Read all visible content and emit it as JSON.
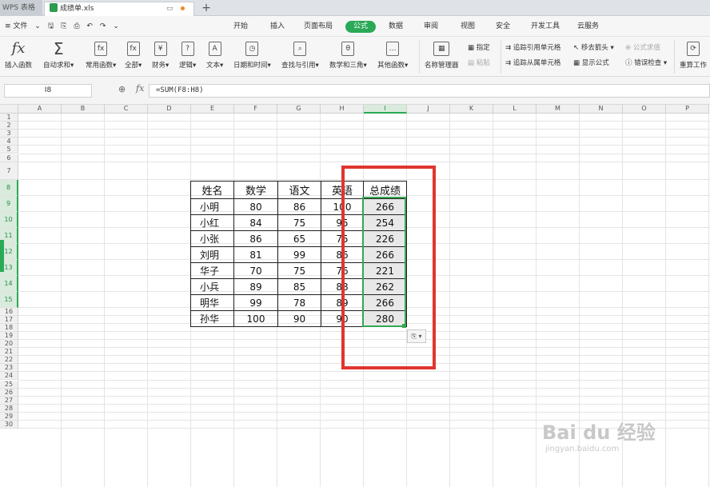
{
  "tabs": {
    "app": "WPS 表格",
    "document": "成绩单.xls",
    "monitor_icon": "monitor-icon",
    "new_tab": "+"
  },
  "menu": {
    "file": "≡ 文件",
    "quick": [
      "⌄",
      "🖫",
      "⎘",
      "⎙",
      "↶",
      "↷",
      "⌄"
    ],
    "items": [
      "开始",
      "插入",
      "页面布局",
      "公式",
      "数据",
      "审阅",
      "视图",
      "安全",
      "开发工具",
      "云服务"
    ],
    "active": "公式"
  },
  "ribbon": {
    "insert_fn": "插入函数",
    "autosum": "自动求和",
    "common": "常用函数",
    "all": "全部",
    "finance": "财务",
    "logic": "逻辑",
    "text": "文本",
    "datetime": "日期和时间",
    "lookup": "查找与引用",
    "math": "数学和三角",
    "other": "其他函数",
    "name_mgr": "名称管理器",
    "specify": "指定",
    "paste": "粘贴",
    "trace_prec": "追踪引用单元格",
    "trace_dep": "追踪从属单元格",
    "remove_arrows": "移去箭头",
    "show_formula": "显示公式",
    "eval_formula": "公式求值",
    "error_check": "错误检查",
    "recalc": "重算工作"
  },
  "formula_bar": {
    "cell": "I8",
    "zoom_icon": "magnifier-icon",
    "fx": "fx",
    "formula": "=SUM(F8:H8)"
  },
  "columns": [
    "A",
    "B",
    "C",
    "D",
    "E",
    "F",
    "G",
    "H",
    "I",
    "J",
    "K",
    "L",
    "M",
    "N",
    "O",
    "P"
  ],
  "rows": [
    "1",
    "2",
    "3",
    "4",
    "5",
    "6",
    "7",
    "8",
    "9",
    "10",
    "11",
    "12",
    "13",
    "14",
    "15",
    "16",
    "17",
    "18",
    "19",
    "20",
    "21",
    "22",
    "23",
    "24",
    "25",
    "26",
    "27",
    "28",
    "29",
    "30"
  ],
  "sheet": {
    "header": [
      "姓名",
      "数学",
      "语文",
      "英语",
      "总成绩"
    ],
    "data": [
      [
        "小明",
        "80",
        "86",
        "100",
        "266"
      ],
      [
        "小红",
        "84",
        "75",
        "95",
        "254"
      ],
      [
        "小张",
        "86",
        "65",
        "75",
        "226"
      ],
      [
        "刘明",
        "81",
        "99",
        "86",
        "266"
      ],
      [
        "华子",
        "70",
        "75",
        "76",
        "221"
      ],
      [
        "小兵",
        "89",
        "85",
        "88",
        "262"
      ],
      [
        "明华",
        "99",
        "78",
        "89",
        "266"
      ],
      [
        "孙华",
        "100",
        "90",
        "90",
        "280"
      ]
    ]
  },
  "paste_options": "⎘ ▾",
  "watermark": {
    "brand": "Bai du 经验",
    "url": "jingyan.baidu.com"
  },
  "colors": {
    "accent": "#2aa957",
    "highlight": "#e0352f"
  }
}
